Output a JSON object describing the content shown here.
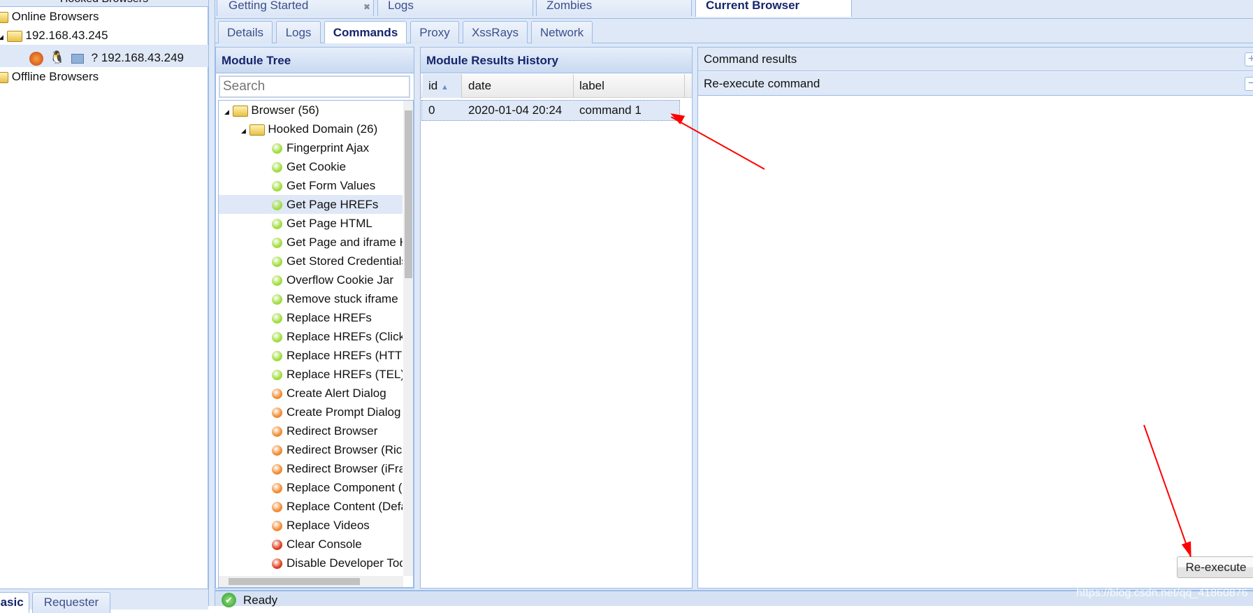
{
  "left_panel": {
    "title": "Hooked Browsers",
    "online": "Online Browsers",
    "host_group": "192.168.43.245",
    "host": "192.168.43.249",
    "host_icons": [
      "firefox-icon",
      "linux-icon",
      "desktop-icon",
      "question-icon"
    ],
    "offline": "Offline Browsers",
    "bottom_tabs": [
      "Basic",
      "Requester"
    ]
  },
  "top_tabs": [
    {
      "label": "Getting Started",
      "closable": true
    },
    {
      "label": "Logs"
    },
    {
      "label": "Zombies"
    },
    {
      "label": "Current Browser",
      "active": true
    }
  ],
  "sub_tabs": [
    "Details",
    "Logs",
    "Commands",
    "Proxy",
    "XssRays",
    "Network"
  ],
  "active_sub_tab": "Commands",
  "module_tree": {
    "title": "Module Tree",
    "search_placeholder": "Search",
    "root": "Browser (56)",
    "domain": "Hooked Domain (26)",
    "items": [
      {
        "label": "Fingerprint Ajax",
        "status": "green"
      },
      {
        "label": "Get Cookie",
        "status": "green"
      },
      {
        "label": "Get Form Values",
        "status": "green"
      },
      {
        "label": "Get Page HREFs",
        "status": "green",
        "selected": true
      },
      {
        "label": "Get Page HTML",
        "status": "green"
      },
      {
        "label": "Get Page and iframe HTML",
        "status": "green"
      },
      {
        "label": "Get Stored Credentials",
        "status": "green"
      },
      {
        "label": "Overflow Cookie Jar",
        "status": "green"
      },
      {
        "label": "Remove stuck iframe",
        "status": "green"
      },
      {
        "label": "Replace HREFs",
        "status": "green"
      },
      {
        "label": "Replace HREFs (Click Events)",
        "status": "green"
      },
      {
        "label": "Replace HREFs (HTTPS)",
        "status": "green"
      },
      {
        "label": "Replace HREFs (TEL)",
        "status": "green"
      },
      {
        "label": "Create Alert Dialog",
        "status": "orange"
      },
      {
        "label": "Create Prompt Dialog",
        "status": "orange"
      },
      {
        "label": "Redirect Browser",
        "status": "orange"
      },
      {
        "label": "Redirect Browser (Rickroll)",
        "status": "orange"
      },
      {
        "label": "Redirect Browser (iFrame)",
        "status": "orange"
      },
      {
        "label": "Replace Component (Deface)",
        "status": "orange"
      },
      {
        "label": "Replace Content (Deface)",
        "status": "orange"
      },
      {
        "label": "Replace Videos",
        "status": "orange"
      },
      {
        "label": "Clear Console",
        "status": "red"
      },
      {
        "label": "Disable Developer Tools",
        "status": "red"
      }
    ]
  },
  "status_colors": {
    "green": "#9fdc3c",
    "orange": "#f08a30",
    "red": "#dd3b1e"
  },
  "results_history": {
    "title": "Module Results History",
    "columns": [
      "id",
      "date",
      "label"
    ],
    "sort": "id ascending",
    "rows": [
      {
        "id": "0",
        "date": "2020-01-04 20:24",
        "label": "command 1"
      }
    ]
  },
  "command_panel": {
    "results_label": "Command results",
    "reexecute_label": "Re-execute command",
    "button": "Re-execute"
  },
  "status_bar": {
    "text": "Ready"
  },
  "watermark": "https://blog.csdn.net/qq_41860876"
}
